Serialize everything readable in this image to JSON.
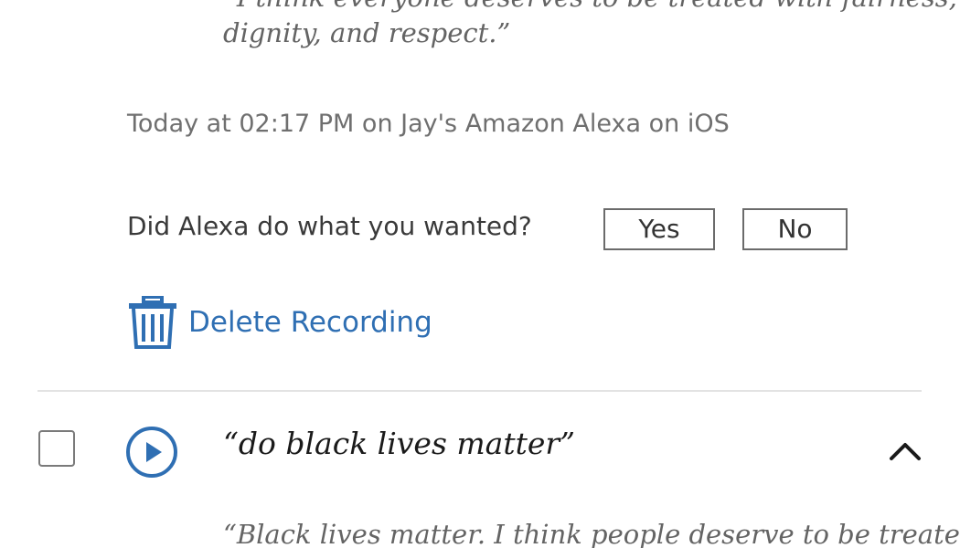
{
  "previous_entry": {
    "response_line1": "“I think everyone deserves to be treated with fairness,",
    "response_line2": "dignity, and respect.”",
    "timestamp": "Today at 02:17 PM on Jay's Amazon Alexa on iOS",
    "feedback": {
      "question": "Did Alexa do what you wanted?",
      "yes_label": "Yes",
      "no_label": "No"
    },
    "delete_label": "Delete Recording",
    "delete_icon": "trash-icon"
  },
  "current_entry": {
    "utterance": "“do black lives matter”",
    "play_icon": "play-circle-icon",
    "collapse_icon": "chevron-up-icon",
    "response_partial": "“Black lives matter. I think people deserve to be treated"
  },
  "colors": {
    "accent": "#2f6fb3",
    "muted_text": "#6f6f6f",
    "divider": "#e3e3e3"
  }
}
